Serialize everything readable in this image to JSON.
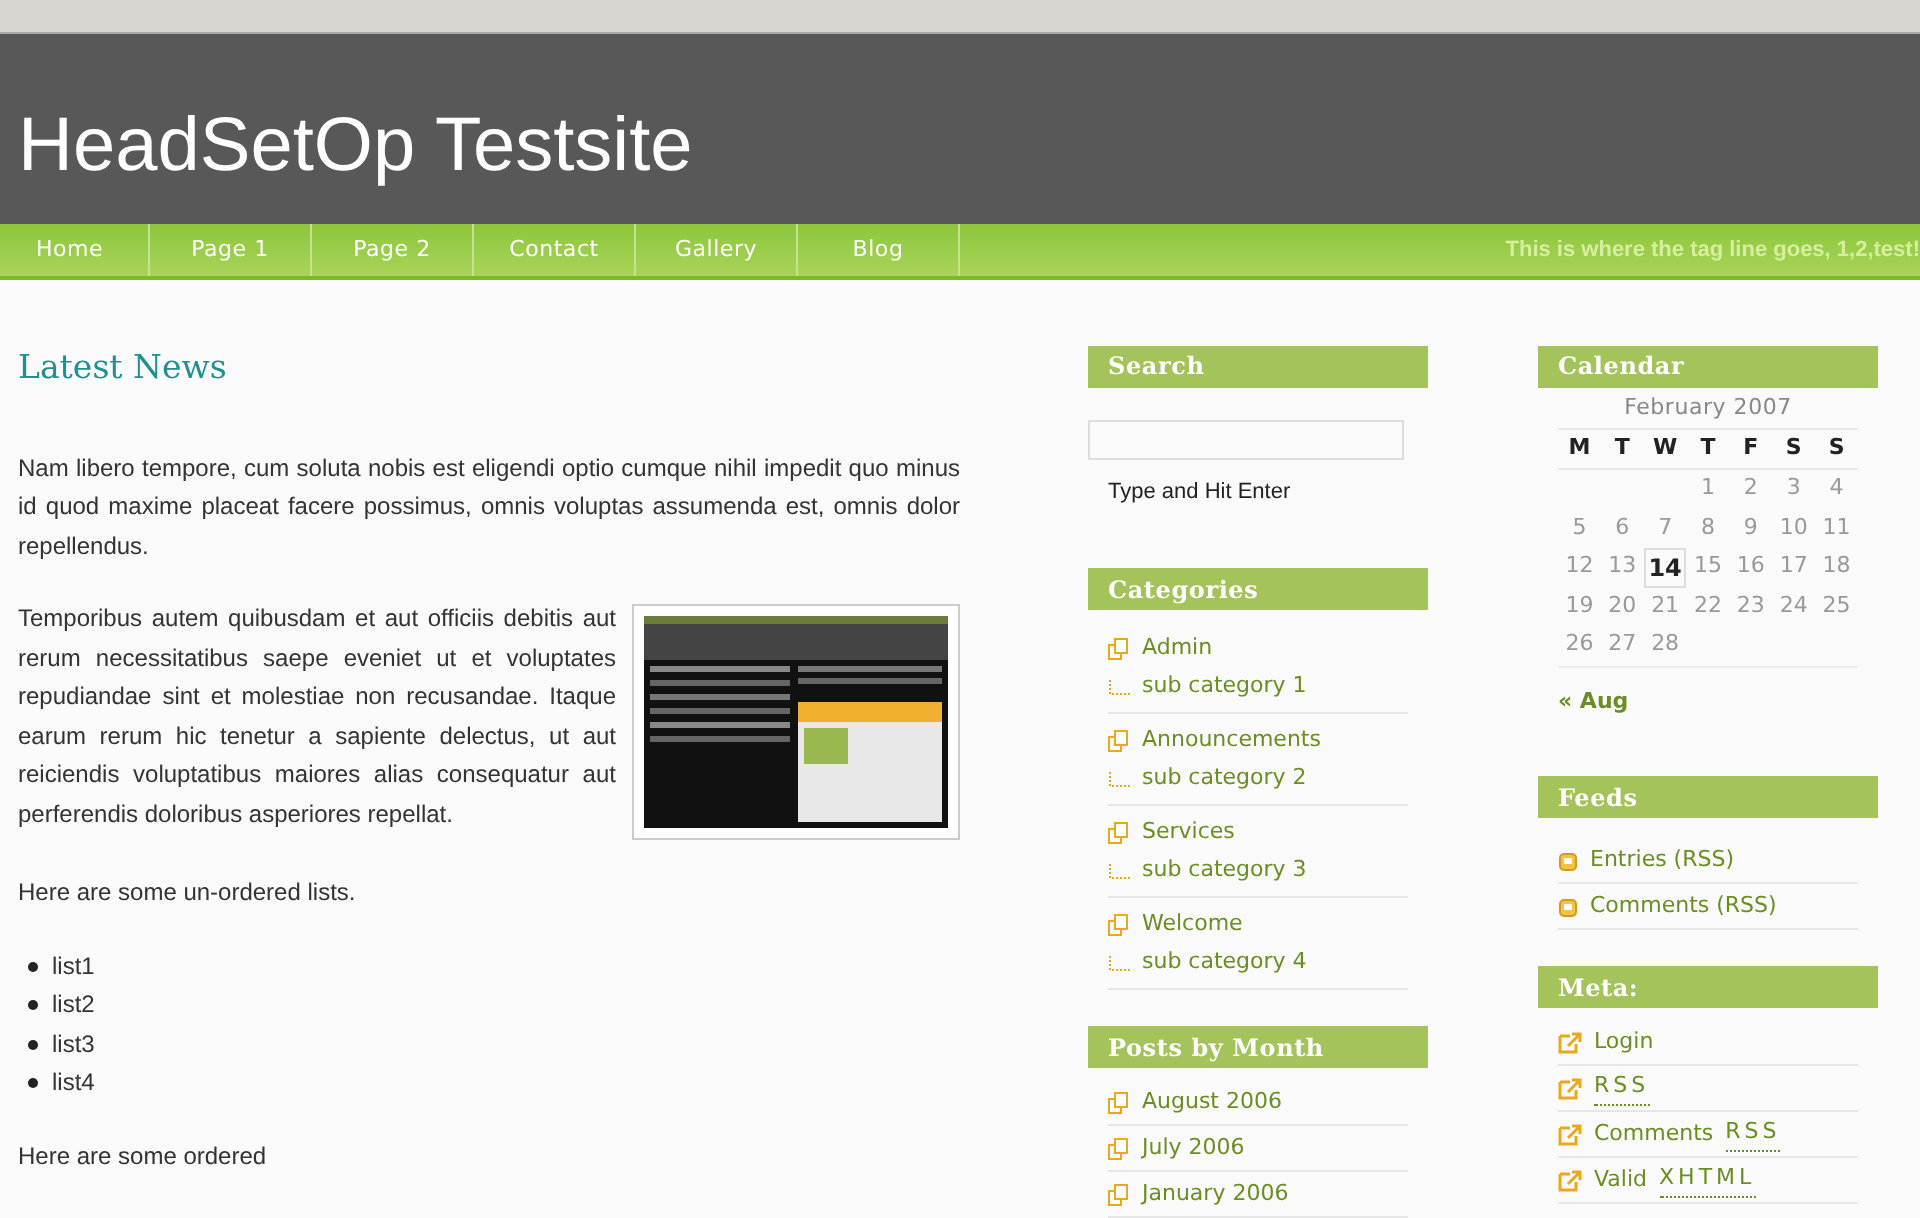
{
  "site": {
    "title": "HeadSetOp Testsite",
    "tagline": "This is where the tag line goes, 1,2,test!"
  },
  "nav": [
    {
      "label": "Home",
      "selected": false
    },
    {
      "label": "Page 1",
      "selected": false
    },
    {
      "label": "Page 2",
      "selected": false
    },
    {
      "label": "Contact",
      "selected": false
    },
    {
      "label": "Gallery",
      "selected": false
    },
    {
      "label": "Blog",
      "selected": false
    }
  ],
  "post": {
    "title": "Latest News",
    "paragraph_1": "Nam libero tempore, cum soluta nobis est eligendi optio cumque nihil impedit quo minus id quod maxime placeat facere possimus, omnis voluptas assumenda est, omnis dolor repellendus.",
    "paragraph_2": "Temporibus autem quibusdam et aut officiis debitis aut rerum necessitatibus saepe eveniet ut et voluptates repudiandae sint et molestiae non recusandae. Itaque earum rerum hic tenetur a sapiente delectus, ut aut reiciendis voluptatibus maiores alias consequatur aut perferendis doloribus asperiores repellat.",
    "paragraph_3": "Here are some un-ordered lists.",
    "list": [
      "list1",
      "list2",
      "list3",
      "list4"
    ],
    "paragraph_4": "Here are some ordered"
  },
  "search": {
    "title": "Search",
    "hint": "Type and Hit Enter"
  },
  "categories": {
    "title": "Categories",
    "items": [
      {
        "label": "Admin",
        "children": [
          {
            "label": "sub category 1"
          }
        ]
      },
      {
        "label": "Announcements",
        "children": [
          {
            "label": "sub category 2"
          }
        ]
      },
      {
        "label": "Services",
        "children": [
          {
            "label": "sub category 3"
          }
        ]
      },
      {
        "label": "Welcome",
        "children": [
          {
            "label": "sub category 4"
          }
        ]
      }
    ]
  },
  "posts_by_month": {
    "title": "Posts by Month",
    "items": [
      "August 2006",
      "July 2006",
      "January 2006"
    ]
  },
  "calendar": {
    "title": "Calendar",
    "caption": "February 2007",
    "weekdays": [
      "M",
      "T",
      "W",
      "T",
      "F",
      "S",
      "S"
    ],
    "weeks": [
      [
        {
          "kind": "blank"
        },
        {
          "kind": "blank"
        },
        {
          "kind": "blank"
        },
        {
          "day": "1",
          "today": false
        },
        {
          "day": "2",
          "today": false
        },
        {
          "day": "3",
          "today": false
        },
        {
          "day": "4",
          "today": false
        }
      ],
      [
        {
          "day": "5",
          "today": false
        },
        {
          "day": "6",
          "today": false
        },
        {
          "day": "7",
          "today": false
        },
        {
          "day": "8",
          "today": false
        },
        {
          "day": "9",
          "today": false
        },
        {
          "day": "10",
          "today": false
        },
        {
          "day": "11",
          "today": false
        }
      ],
      [
        {
          "day": "12",
          "today": false
        },
        {
          "day": "13",
          "today": false
        },
        {
          "day": "14",
          "today": true
        },
        {
          "day": "15",
          "today": false
        },
        {
          "day": "16",
          "today": false
        },
        {
          "day": "17",
          "today": false
        },
        {
          "day": "18",
          "today": false
        }
      ],
      [
        {
          "day": "19",
          "today": false
        },
        {
          "day": "20",
          "today": false
        },
        {
          "day": "21",
          "today": false
        },
        {
          "day": "22",
          "today": false
        },
        {
          "day": "23",
          "today": false
        },
        {
          "day": "24",
          "today": false
        },
        {
          "day": "25",
          "today": false
        }
      ],
      [
        {
          "day": "26",
          "today": false
        },
        {
          "day": "27",
          "today": false
        },
        {
          "day": "28",
          "today": false
        }
      ]
    ],
    "prev": "« Aug"
  },
  "feeds": {
    "title": "Feeds",
    "items": [
      "Entries (RSS)",
      "Comments (RSS)"
    ]
  },
  "meta": {
    "title": "Meta:",
    "items": [
      {
        "text": "Login"
      },
      {
        "abbr": "RSS"
      },
      {
        "text": "Comments",
        "abbr": "RSS"
      },
      {
        "text": "Valid",
        "abbr": "XHTML"
      }
    ]
  }
}
